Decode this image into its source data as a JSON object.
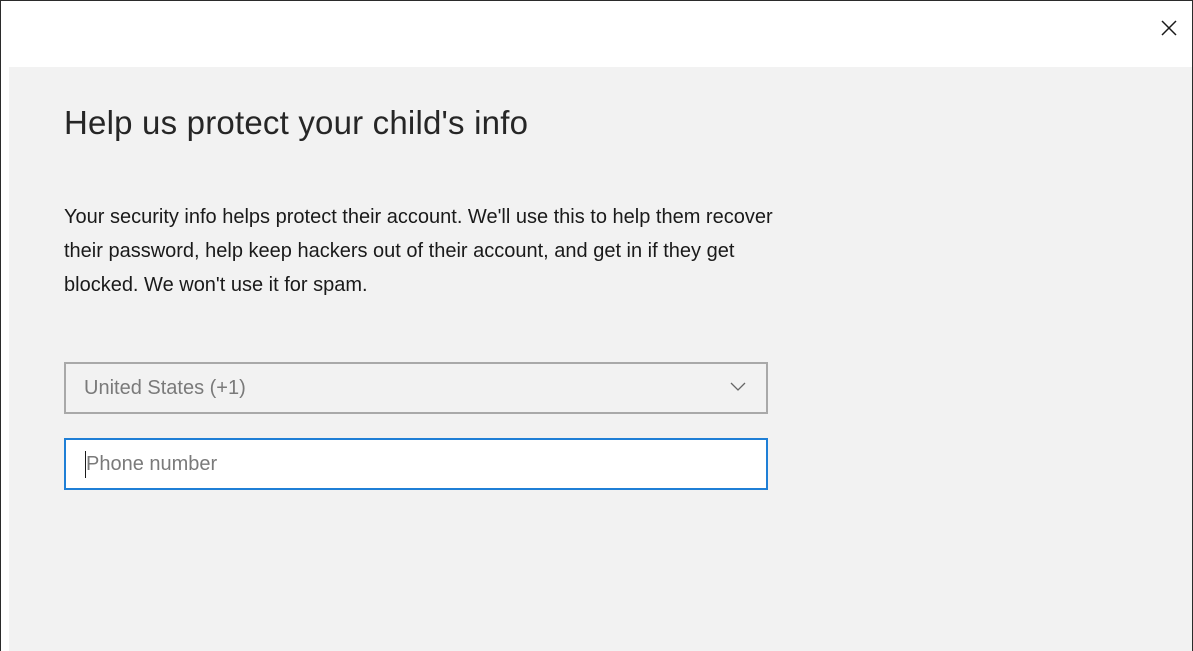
{
  "window": {
    "close_icon": "close-icon"
  },
  "main": {
    "heading": "Help us protect your child's info",
    "description": "Your security info helps protect their account. We'll use this to help them recover\ntheir password, help keep hackers out of their account, and get in if they get\nblocked. We won't use it for spam.",
    "country_select": {
      "value": "United States (+1)",
      "icon": "chevron-down-icon"
    },
    "phone_input": {
      "placeholder": "Phone number",
      "value": ""
    }
  },
  "colors": {
    "content_background": "#f2f2f2",
    "focus_border": "#1f7fd6",
    "select_border": "#a9a9a9",
    "placeholder_text": "#7a7a7a"
  }
}
